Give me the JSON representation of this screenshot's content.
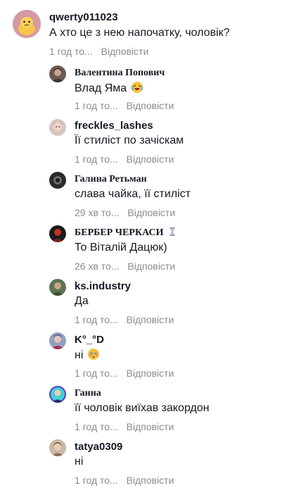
{
  "colors": {
    "text": "#161823",
    "secondary": "#8a8b91",
    "background": "#ffffff"
  },
  "top_comment": {
    "username": "qwerty011023",
    "text": "А хто це з нею напочатку, чоловік?",
    "time": "1 год то...",
    "reply_label": "Відповісти",
    "avatar_icon": "yellow-cartoon-avatar-icon"
  },
  "replies": [
    {
      "username": "Валентина Попович",
      "text": "Влад Яма",
      "emoji_icon": "rolling-laughing-emoji-icon",
      "time": "1 год то...",
      "reply_label": "Відповісти"
    },
    {
      "username": "freckles_lashes",
      "text": "Її стиліст по зачіскам",
      "time": "1 год то...",
      "reply_label": "Відповісти"
    },
    {
      "username": "Галина Ретьман",
      "text": "слава чайка, її стиліст",
      "time": "29 хв то...",
      "reply_label": "Відповісти"
    },
    {
      "username": "БЕРБЕР ЧЕРКАСИ",
      "badge_icon": "hourglass-icon",
      "text": "То Віталій Дацюк)",
      "time": "26 хв то...",
      "reply_label": "Відповісти"
    },
    {
      "username": "ks.industry",
      "text": "Да",
      "time": "1 год то...",
      "reply_label": "Відповісти"
    },
    {
      "username": "K°_°D",
      "text": "ні",
      "emoji_icon": "flushed-face-emoji-icon",
      "time": "1 год то...",
      "reply_label": "Відповісти"
    },
    {
      "username": "Ганна",
      "text": "її чоловік виїхав закордон",
      "time": "1 год то...",
      "reply_label": "Відповісти"
    },
    {
      "username": "tatya0309",
      "text": "ні",
      "time": "1 год то...",
      "reply_label": "Відповісти"
    }
  ]
}
